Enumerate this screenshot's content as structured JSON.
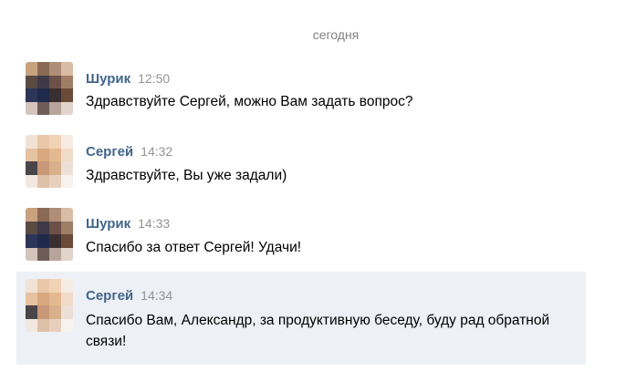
{
  "date_separator": "сегодня",
  "messages": [
    {
      "author": "Шурик",
      "time": "12:50",
      "text": "Здравствуйте Сергей, можно Вам задать вопрос?",
      "avatar": "avatar-shurik"
    },
    {
      "author": "Сергей",
      "time": "14:32",
      "text": "Здравствуйте, Вы уже задали)",
      "avatar": "avatar-sergey"
    },
    {
      "author": "Шурик",
      "time": "14:33",
      "text": "Спасибо за ответ Сергей! Удачи!",
      "avatar": "avatar-shurik"
    },
    {
      "author": "Сергей",
      "time": "14:34",
      "text": "Спасибо Вам, Александр, за продуктивную беседу, буду рад обратной связи!",
      "avatar": "avatar-sergey",
      "highlighted": true
    }
  ],
  "colors": {
    "author": "#42648b",
    "time": "#939393",
    "highlight_bg": "#edf0f5",
    "date": "#828282"
  }
}
